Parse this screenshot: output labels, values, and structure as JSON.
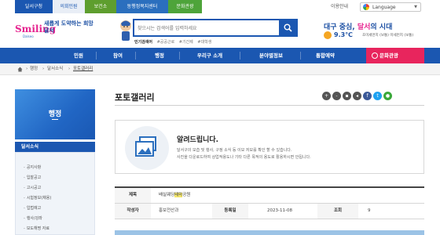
{
  "top_tabs": [
    "달서구청",
    "의회민원",
    "보건소",
    "동행정복지센터",
    "문화관광"
  ],
  "utility": {
    "guide": "이용안내",
    "language": "Language"
  },
  "logo": {
    "main": "Smiling",
    "sub": "Dalseo",
    "slogan": "새롭게 도약하는 희망 달서"
  },
  "search": {
    "placeholder": "찾으시는 검색어를 입력하세요",
    "popular_label": "인기검색어",
    "popular_tags": [
      "#공공근로",
      "#기간제",
      "#대학생"
    ]
  },
  "weather": {
    "title_prefix": "대구 중심, ",
    "title_accent": "달서",
    "title_suffix": "의 시대",
    "temperature": "9.3℃",
    "dust": "초미세먼지 (보통) 미세먼지 (보통)"
  },
  "gnb": {
    "items": [
      "민원",
      "참여",
      "행정",
      "우리구 소개",
      "분야별정보",
      "통합예약"
    ],
    "culture": "문화관광"
  },
  "breadcrumb": [
    "행정",
    "달서소식",
    "포토갤러리"
  ],
  "sidebar": {
    "title": "행정",
    "section": "달서소식",
    "items": [
      "공지사항",
      "입찰공고",
      "고시공고",
      "시험정보(채용)",
      "입법예고",
      "행사/강좌",
      "보도해명 자료"
    ]
  },
  "content": {
    "title": "포토갤러리",
    "tools": [
      "+",
      "-",
      "print",
      "share",
      "facebook",
      "twitter",
      "kakao"
    ],
    "notice": {
      "heading": "알려드립니다.",
      "lines": [
        "달서구의 모습 및 행사, 구정 소식 등 이모 저모를 확인 할 수 있습니다.",
        "사진을 다운로드하여 상업적용도나 기타 다른 목적의 용도로 활용하시면 안됩니다."
      ]
    },
    "board": {
      "subject_label": "제목",
      "subject_pre": "배실웨딩",
      "subject_highlight": "테마",
      "subject_post": "공원",
      "writer_label": "작성자",
      "writer": "홍보전산과",
      "date_label": "등록일",
      "date": "2023-11-08",
      "views_label": "조회",
      "views": "9"
    }
  },
  "colors": {
    "primary": "#1b57b1",
    "accent": "#e6238f",
    "culture": "#e8255d"
  }
}
